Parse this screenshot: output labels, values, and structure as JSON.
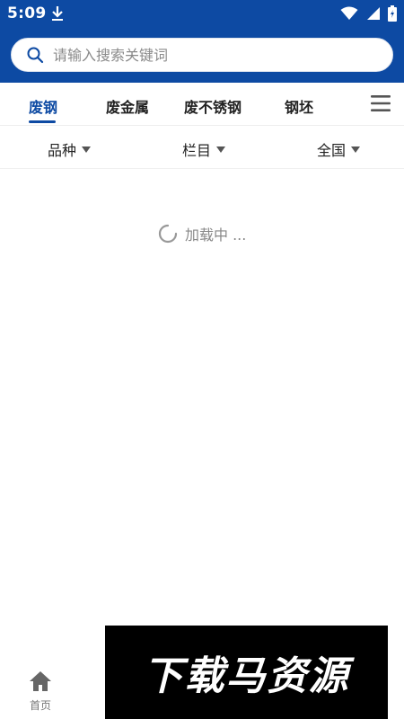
{
  "status_bar": {
    "time": "5:09",
    "icons": [
      "download-icon",
      "wifi-icon",
      "signal-icon",
      "battery-icon"
    ]
  },
  "search": {
    "placeholder": "请输入搜索关键词",
    "value": ""
  },
  "tabs": [
    {
      "label": "废钢",
      "active": true
    },
    {
      "label": "废金属",
      "active": false
    },
    {
      "label": "废不锈钢",
      "active": false
    },
    {
      "label": "钢坯",
      "active": false
    }
  ],
  "filters": [
    {
      "label": "品种"
    },
    {
      "label": "栏目"
    },
    {
      "label": "全国"
    }
  ],
  "loading": {
    "text": "加载中 ..."
  },
  "bottom_nav": {
    "home_label": "首页"
  },
  "watermark": {
    "text": "下载马资源"
  },
  "colors": {
    "primary": "#0d4aa3",
    "text": "#222222",
    "muted": "#888888",
    "background": "#ffffff"
  }
}
